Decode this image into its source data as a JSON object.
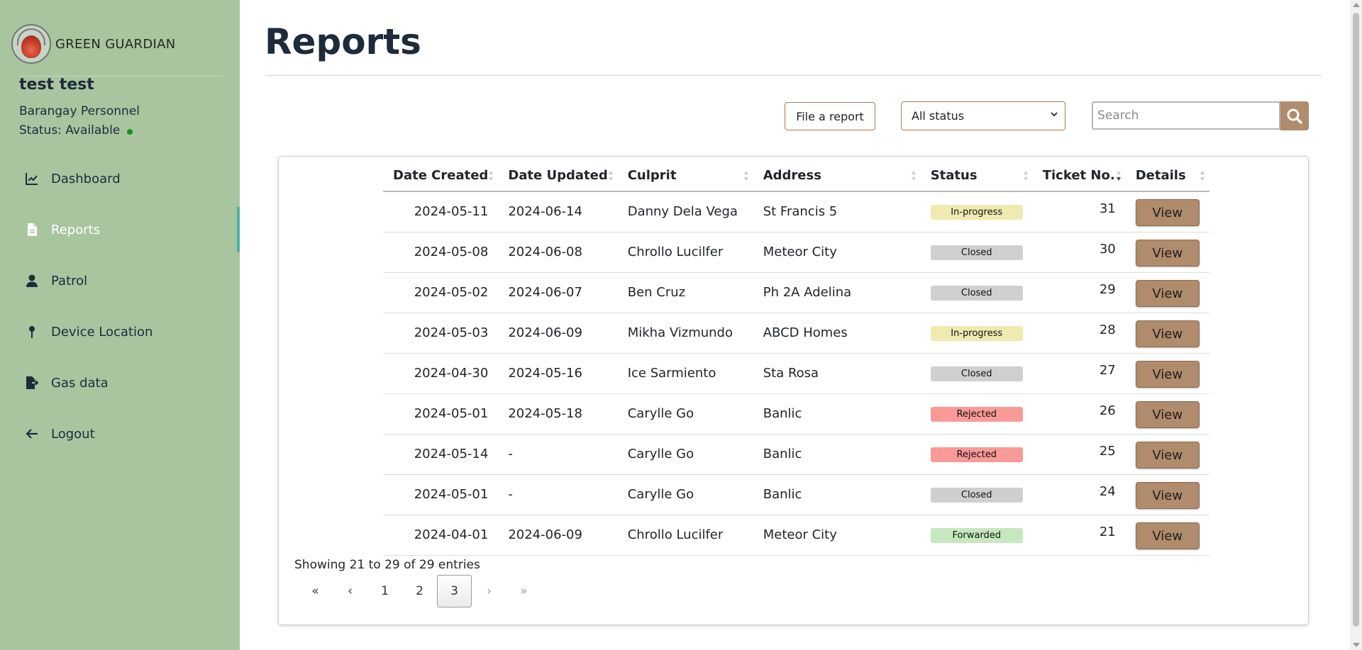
{
  "brand": {
    "name": "GREEN GUARDIAN",
    "logo_icon": "flame-logo-icon"
  },
  "user": {
    "name": "test test",
    "role": "Barangay Personnel",
    "status": "Status: Available",
    "status_color": "#1a8f1a"
  },
  "sidebar": {
    "items": [
      {
        "label": "Dashboard",
        "icon": "chart-line-icon",
        "active": false
      },
      {
        "label": "Reports",
        "icon": "file-icon",
        "active": true
      },
      {
        "label": "Patrol",
        "icon": "person-icon",
        "active": false
      },
      {
        "label": "Device Location",
        "icon": "map-pin-icon",
        "active": false
      },
      {
        "label": "Gas data",
        "icon": "file-export-icon",
        "active": false
      },
      {
        "label": "Logout",
        "icon": "arrow-left-icon",
        "active": false
      }
    ]
  },
  "page": {
    "title": "Reports"
  },
  "toolbar": {
    "file_report_label": "File a report",
    "status_filter": {
      "selected": "All status"
    },
    "search": {
      "placeholder": "Search",
      "value": ""
    }
  },
  "table": {
    "columns": [
      "Date Created",
      "Date Updated",
      "Culprit",
      "Address",
      "Status",
      "Ticket No.",
      "Details"
    ],
    "rows": [
      {
        "date_created": "2024-05-11",
        "date_updated": "2024-06-14",
        "culprit": "Danny Dela Vega",
        "address": "St Francis 5",
        "status": "In-progress",
        "ticket": "31",
        "details": "View"
      },
      {
        "date_created": "2024-05-08",
        "date_updated": "2024-06-08",
        "culprit": "Chrollo Lucilfer",
        "address": "Meteor City",
        "status": "Closed",
        "ticket": "30",
        "details": "View"
      },
      {
        "date_created": "2024-05-02",
        "date_updated": "2024-06-07",
        "culprit": "Ben Cruz",
        "address": "Ph 2A Adelina",
        "status": "Closed",
        "ticket": "29",
        "details": "View"
      },
      {
        "date_created": "2024-05-03",
        "date_updated": "2024-06-09",
        "culprit": "Mikha Vizmundo",
        "address": "ABCD Homes",
        "status": "In-progress",
        "ticket": "28",
        "details": "View"
      },
      {
        "date_created": "2024-04-30",
        "date_updated": "2024-05-16",
        "culprit": "Ice Sarmiento",
        "address": "Sta Rosa",
        "status": "Closed",
        "ticket": "27",
        "details": "View"
      },
      {
        "date_created": "2024-05-01",
        "date_updated": "2024-05-18",
        "culprit": "Carylle Go",
        "address": "Banlic",
        "status": "Rejected",
        "ticket": "26",
        "details": "View"
      },
      {
        "date_created": "2024-05-14",
        "date_updated": "-",
        "culprit": "Carylle Go",
        "address": "Banlic",
        "status": "Rejected",
        "ticket": "25",
        "details": "View"
      },
      {
        "date_created": "2024-05-01",
        "date_updated": "-",
        "culprit": "Carylle Go",
        "address": "Banlic",
        "status": "Closed",
        "ticket": "24",
        "details": "View"
      },
      {
        "date_created": "2024-04-01",
        "date_updated": "2024-06-09",
        "culprit": "Chrollo Lucilfer",
        "address": "Meteor City",
        "status": "Forwarded",
        "ticket": "21",
        "details": "View"
      }
    ]
  },
  "status_colors": {
    "In-progress": "#f0eab0",
    "Closed": "#cfcfcf",
    "Rejected": "#f99a96",
    "Forwarded": "#c6e8be"
  },
  "footer": {
    "entries_info": "Showing 21 to 29 of 29 entries",
    "pagination": [
      "«",
      "‹",
      "1",
      "2",
      "3",
      "›",
      "»"
    ],
    "current_page": "3"
  },
  "colors": {
    "sidebar_bg": "#a8c5a0",
    "accent": "#b08b6c",
    "active_indicator": "#4fb3a3"
  }
}
